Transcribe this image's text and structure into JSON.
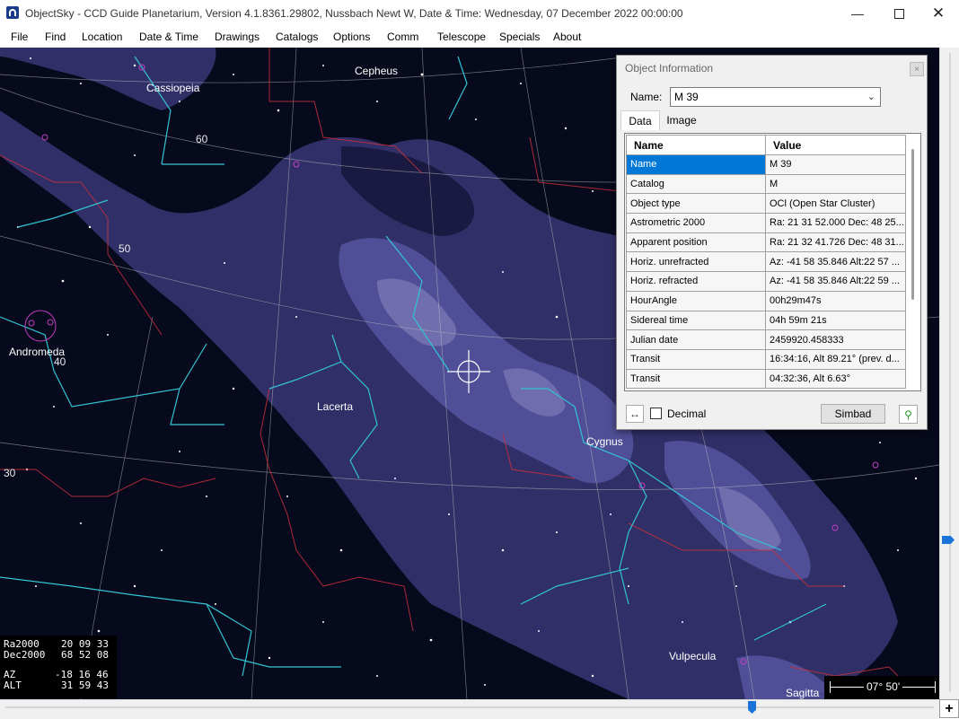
{
  "window": {
    "title": "ObjectSky - CCD Guide Planetarium, Version 4.1.8361.29802, Nussbach Newt W, Date & Time: Wednesday, 07 December 2022 00:00:00",
    "minimize_icon": "minimize-icon",
    "maximize_icon": "maximize-icon",
    "close_icon": "close-icon"
  },
  "menu": {
    "items": [
      "File",
      "Find",
      "Location",
      "Date & Time",
      "Drawings",
      "Catalogs",
      "Options",
      "Comm",
      "Telescope",
      "Specials",
      "About"
    ]
  },
  "sky": {
    "constellations": [
      "Cepheus",
      "Cassiopeia",
      "Andromeda",
      "Lacerta",
      "Cygnus",
      "Vulpecula",
      "Sagitta"
    ],
    "grid_labels": [
      "60",
      "50",
      "40",
      "30"
    ],
    "colors": {
      "background": "#070a1c",
      "milky_way": "#3c3a78",
      "constellation_lines": "#33c3d4",
      "boundaries": "#c8303c",
      "grid": "#c8c8c8"
    }
  },
  "coordinates": {
    "ra_label": "Ra2000",
    "ra_value": "20 09 33",
    "dec_label": "Dec2000",
    "dec_value": "68 52 08",
    "az_label": "AZ",
    "az_value": "-18 16 46",
    "alt_label": "ALT",
    "alt_value": "31 59 43"
  },
  "scale": {
    "field": "07° 50'"
  },
  "dialog": {
    "title": "Object Information",
    "close_label": "×",
    "name_label": "Name:",
    "name_value": "M 39",
    "tabs": [
      "Data",
      "Image"
    ],
    "columns": [
      "Name",
      "Value"
    ],
    "rows": [
      {
        "name": "Name",
        "value": "M 39"
      },
      {
        "name": "Catalog",
        "value": "M"
      },
      {
        "name": "Object type",
        "value": "OCl (Open Star Cluster)"
      },
      {
        "name": "Astrometric 2000",
        "value": "Ra: 21 31 52.000  Dec: 48 25..."
      },
      {
        "name": "Apparent position",
        "value": "Ra: 21 32 41.726  Dec: 48 31..."
      },
      {
        "name": "Horiz. unrefracted",
        "value": "Az: -41 58 35.846 Alt:22 57 ..."
      },
      {
        "name": "Horiz. refracted",
        "value": "Az: -41 58 35.846 Alt:22 59 ..."
      },
      {
        "name": "HourAngle",
        "value": "00h29m47s"
      },
      {
        "name": "Sidereal time",
        "value": "04h 59m 21s"
      },
      {
        "name": "Julian date",
        "value": "2459920.458333"
      },
      {
        "name": "Transit",
        "value": "16:34:16, Alt 89.21° (prev. d..."
      },
      {
        "name": "Transit",
        "value": "04:32:36, Alt 6.63°"
      }
    ],
    "decimal_label": "Decimal",
    "decimal_checked": false,
    "simbad_label": "Simbad"
  },
  "scrollbar": {
    "plus_label": "+"
  }
}
